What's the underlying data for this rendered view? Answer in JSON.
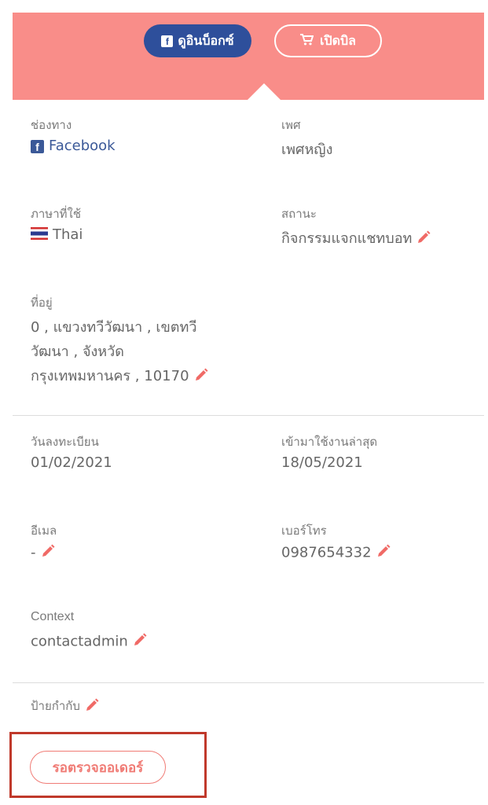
{
  "header": {
    "inbox_label": "ดูอินบ็อกซ์",
    "bill_label": "เปิดบิล",
    "color": "#f98d89",
    "inbox_color": "#2e4f9b",
    "inbox_icon": "facebook-icon",
    "bill_icon": "cart-icon"
  },
  "fields": {
    "channel": {
      "label": "ช่องทาง",
      "value": "Facebook",
      "icon": "facebook-icon"
    },
    "gender": {
      "label": "เพศ",
      "value": "เพศหญิง"
    },
    "language": {
      "label": "ภาษาที่ใช้",
      "value": "Thai",
      "icon": "thai-flag-icon"
    },
    "status": {
      "label": "สถานะ",
      "value": "กิจกรรมแจกแชทบอท"
    },
    "address": {
      "label": "ที่อยู่",
      "line1": "0 , แขวงทวีวัฒนา , เขตทวี",
      "line2": "วัฒนา , จังหวัด",
      "line3": "กรุงเทพมหานคร , 10170"
    },
    "registered": {
      "label": "วันลงทะเบียน",
      "value": "01/02/2021"
    },
    "last_active": {
      "label": "เข้ามาใช้งานล่าสุด",
      "value": "18/05/2021"
    },
    "email": {
      "label": "อีเมล",
      "value": "-"
    },
    "phone": {
      "label": "เบอร์โทร",
      "value": "0987654332"
    },
    "context": {
      "label": "Context",
      "value": "contactadmin"
    },
    "tags": {
      "label": "ป้ายกำกับ"
    }
  },
  "order_status": {
    "label": "รอตรวจออเดอร์",
    "color": "#f07c76"
  },
  "edit_icon_color": "#f06a66"
}
